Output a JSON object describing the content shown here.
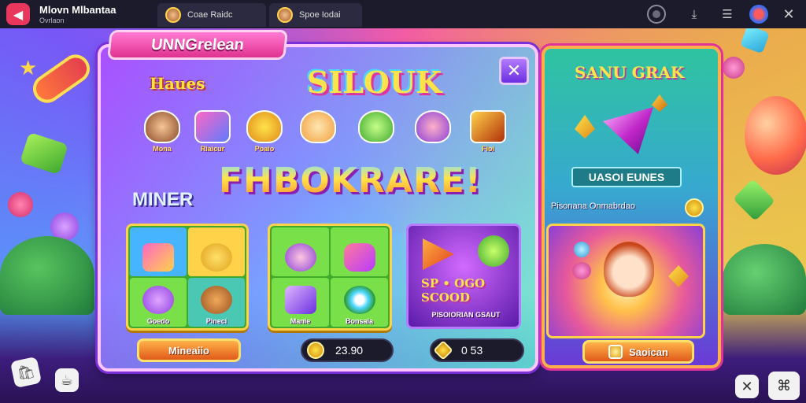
{
  "topbar": {
    "title": "Mlovn Mlbantaa",
    "subtitle": "Ovrlaon",
    "tabs": [
      {
        "label": "Coae Raidc"
      },
      {
        "label": "Spoe Iodai"
      }
    ],
    "icons": {
      "back": "arrow-left-icon",
      "record": "record-icon",
      "download": "download-icon",
      "menu": "menu-icon",
      "brand": "brand-icon",
      "close": "close-icon"
    }
  },
  "main": {
    "banner": "UNNGrelean",
    "label_left": "Haues",
    "label_top": "SILOUK",
    "headline": "FHBOKRARE!",
    "label_mid": "MINER",
    "characters": [
      {
        "label": "Mona"
      },
      {
        "label": "Riaicur"
      },
      {
        "label": "Poaio"
      },
      {
        "label": ""
      },
      {
        "label": ""
      },
      {
        "label": ""
      },
      {
        "label": "Fioi"
      }
    ],
    "grid_a": [
      {
        "label": ""
      },
      {
        "label": ""
      },
      {
        "label": "Goedo"
      },
      {
        "label": "Pineci"
      }
    ],
    "grid_b": [
      {
        "label": ""
      },
      {
        "label": ""
      },
      {
        "label": "Manie"
      },
      {
        "label": "Bonsala"
      }
    ],
    "promo": {
      "big_text": "SP • OGO\nSCOOD",
      "sub_text": "PISOIORIAN GSAUT"
    },
    "button_left": "Mineaiio",
    "currency_a": "23.90",
    "currency_b": "0 53"
  },
  "shop": {
    "title": "SANU GRAK",
    "label": "UASOI EUNES",
    "subtitle": "Pisonana Onmabrdao",
    "button": "Saoican"
  },
  "colors": {
    "accent_pink": "#e0339a",
    "accent_orange": "#e05a1a",
    "gold": "#ffe34a",
    "topbar_bg": "#1c1b2b"
  }
}
